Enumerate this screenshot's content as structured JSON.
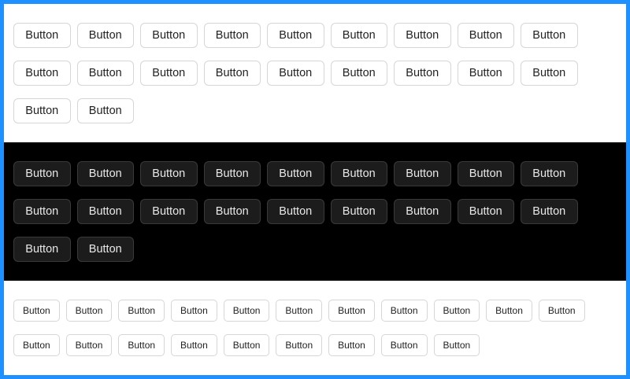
{
  "sections": [
    {
      "theme": "light",
      "button_labels": [
        "Button",
        "Button",
        "Button",
        "Button",
        "Button",
        "Button",
        "Button",
        "Button",
        "Button",
        "Button",
        "Button",
        "Button",
        "Button",
        "Button",
        "Button",
        "Button",
        "Button",
        "Button",
        "Button",
        "Button"
      ]
    },
    {
      "theme": "dark",
      "button_labels": [
        "Button",
        "Button",
        "Button",
        "Button",
        "Button",
        "Button",
        "Button",
        "Button",
        "Button",
        "Button",
        "Button",
        "Button",
        "Button",
        "Button",
        "Button",
        "Button",
        "Button",
        "Button",
        "Button",
        "Button"
      ]
    },
    {
      "theme": "small",
      "button_labels": [
        "Button",
        "Button",
        "Button",
        "Button",
        "Button",
        "Button",
        "Button",
        "Button",
        "Button",
        "Button",
        "Button",
        "Button",
        "Button",
        "Button",
        "Button",
        "Button",
        "Button",
        "Button",
        "Button",
        "Button"
      ]
    }
  ],
  "colors": {
    "frame_border": "#1e90ff",
    "light_bg": "#ffffff",
    "dark_bg": "#000000",
    "light_button_border": "#d6d6d6",
    "dark_button_bg": "#1c1c1c"
  }
}
